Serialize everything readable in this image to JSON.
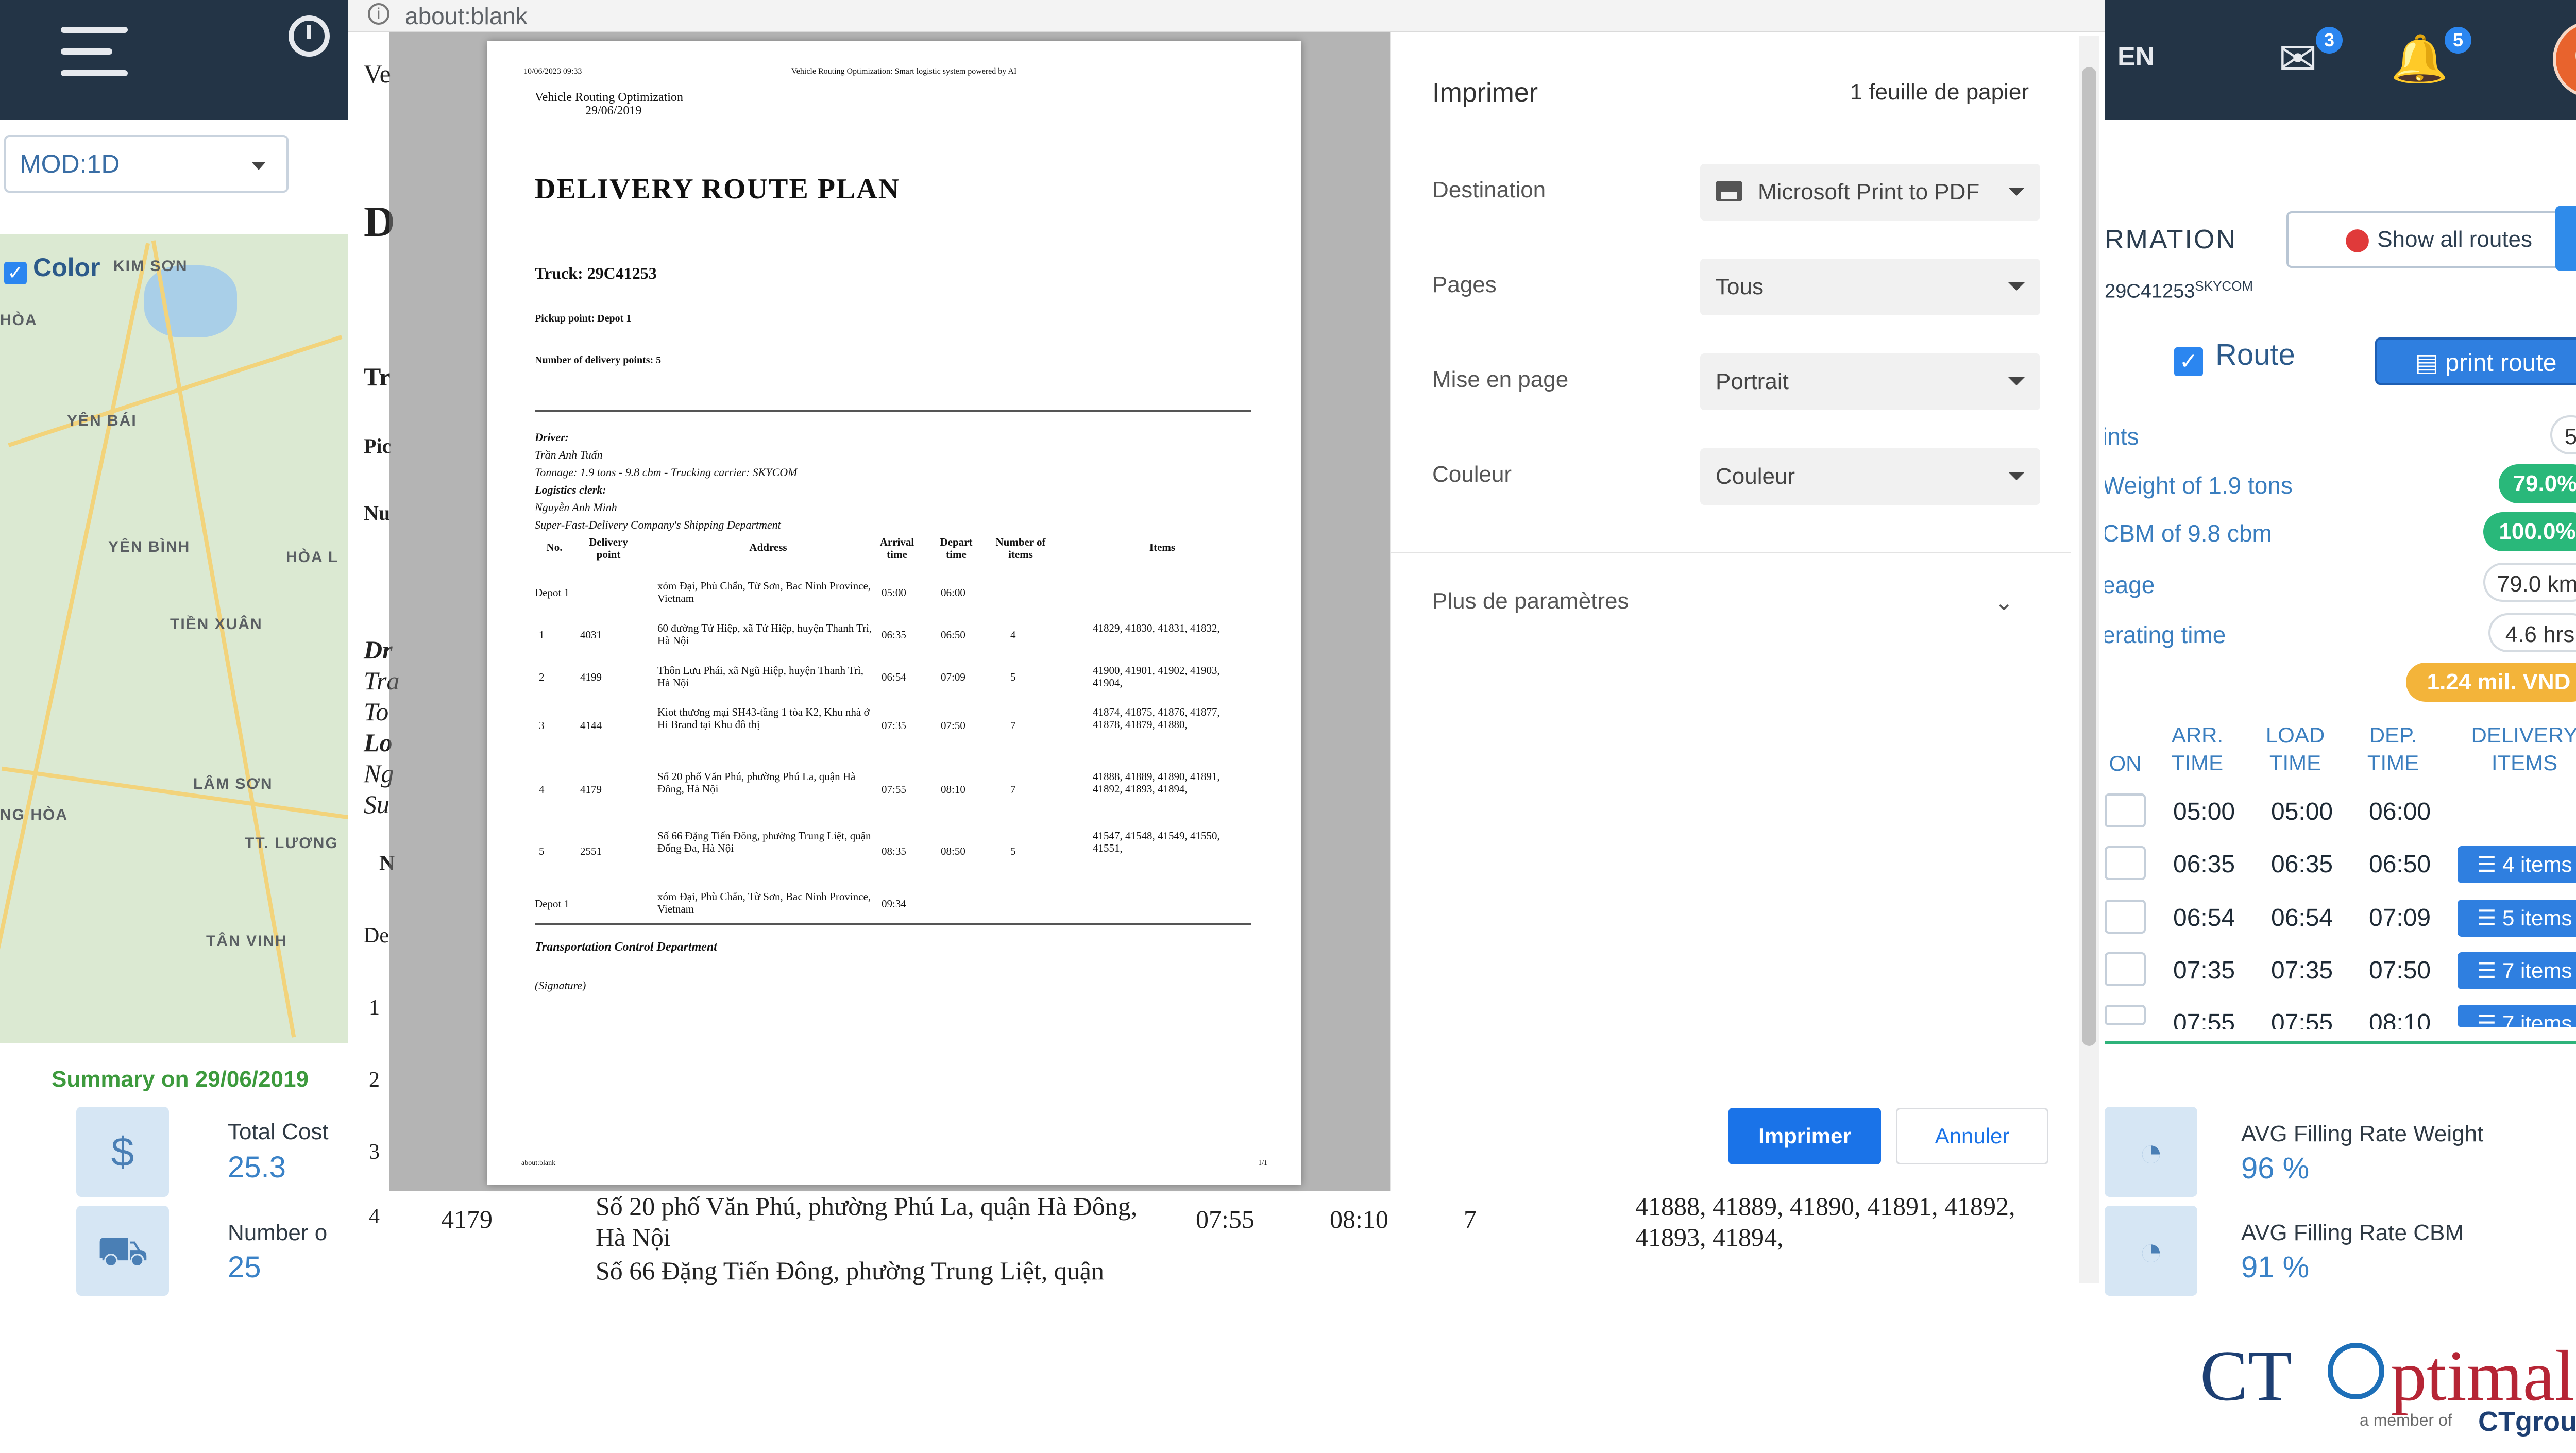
{
  "app": {
    "lang": "EN",
    "mail_badge": "3",
    "bell_badge": "5",
    "mode_select": "MOD:1D",
    "color_label": "Color",
    "map_places": [
      "KIM SƠN",
      "HÒA",
      "YÊN BÁI",
      "YÊN BÌNH",
      "HÒA L",
      "TIỀN XUÂN",
      "LÂM SƠN",
      "NG HÒA",
      "TT. LƯƠNG",
      "TÂN VINH"
    ],
    "summary_title": "Summary on 29/06/2019",
    "total_cost_label": "Total Cost",
    "total_cost_value": "25.3",
    "number_label": "Number o",
    "number_value": "25",
    "left_letters": [
      "Ve",
      "D",
      "Tr",
      "Pic",
      "Nu",
      "Dr",
      "Tra",
      "To",
      "Lo",
      "Ng",
      "Su",
      "N",
      "De",
      "1",
      "2",
      "3",
      "4"
    ],
    "bg_row4": {
      "no": "4",
      "point": "4179",
      "address_1": "Số 20 phố Văn Phú, phường Phú La, quận Hà Đông,",
      "address_2": "Hà Nội",
      "arrive": "07:55",
      "depart": "08:10",
      "num": "7",
      "items_1": "41888, 41889, 41890, 41891, 41892,",
      "items_2": "41893, 41894,"
    },
    "bg_row5_address": "Số 66 Đặng Tiến Đông, phường Trung Liệt, quận"
  },
  "right_panel": {
    "title": "RMATION",
    "show_all_routes": "Show all routes",
    "truck_code": "29C41253",
    "truck_tag": "SKYCOM",
    "route_label": "Route",
    "print_route": "print route",
    "rows": [
      {
        "label": "ints",
        "value": "5",
        "style": "grey"
      },
      {
        "label": "Weight of 1.9 tons",
        "value": "79.0%",
        "style": "green"
      },
      {
        "label": "CBM of 9.8 cbm",
        "value": "100.0%",
        "style": "green"
      },
      {
        "label": "eage",
        "value": "79.0 km",
        "style": "grey"
      },
      {
        "label": "erating time",
        "value": "4.6 hrs",
        "style": "grey"
      },
      {
        "label": "",
        "value": "1.24 mil. VND",
        "style": "orange"
      }
    ],
    "table_headers": [
      "ON",
      "ARR.\nTIME",
      "LOAD\nTIME",
      "DEP.\nTIME",
      "DELIVERY\nITEMS"
    ],
    "table_rows": [
      {
        "arr": "05:00",
        "load": "05:00",
        "dep": "06:00",
        "items": ""
      },
      {
        "arr": "06:35",
        "load": "06:35",
        "dep": "06:50",
        "items": "4 items"
      },
      {
        "arr": "06:54",
        "load": "06:54",
        "dep": "07:09",
        "items": "5 items"
      },
      {
        "arr": "07:35",
        "load": "07:35",
        "dep": "07:50",
        "items": "7 items"
      },
      {
        "arr": "07:55",
        "load": "07:55",
        "dep": "08:10",
        "items": "7 items"
      }
    ],
    "avg_weight_label": "AVG Filling Rate Weight",
    "avg_weight_value": "96 %",
    "avg_cbm_label": "AVG Filling Rate CBM",
    "avg_cbm_value": "91 %"
  },
  "browser": {
    "url": "about:blank"
  },
  "sheet": {
    "header_left": "10/06/2023 09:33",
    "header_center": "Vehicle Routing Optimization: Smart logistic system powered by AI",
    "vro": "Vehicle Routing Optimization",
    "vro_date": "29/06/2019",
    "title": "DELIVERY ROUTE PLAN",
    "truck": "Truck: 29C41253",
    "pickup": "Pickup point: Depot 1",
    "num_points": "Number of delivery points: 5",
    "driver_lines": [
      {
        "text": "Driver:",
        "bold": true
      },
      {
        "text": "Trần Anh Tuấn",
        "bold": false
      },
      {
        "text": "Tonnage: 1.9 tons - 9.8 cbm - Trucking carrier: SKYCOM",
        "bold": false
      },
      {
        "text": "Logistics clerk:",
        "bold": true
      },
      {
        "text": "Nguyễn Anh Minh",
        "bold": false
      },
      {
        "text": "Super-Fast-Delivery Company's Shipping Department",
        "bold": false
      }
    ],
    "table_headers": [
      "No.",
      "Delivery point",
      "Address",
      "Arrival time",
      "Depart time",
      "Number of items",
      "Items"
    ],
    "table_rows": [
      {
        "no": "Depot 1",
        "point": "",
        "address": "xóm Đại, Phù Chẩn, Từ Sơn, Bac Ninh Province, Vietnam",
        "arr": "05:00",
        "dep": "06:00",
        "num": "",
        "items": ""
      },
      {
        "no": "1",
        "point": "4031",
        "address": "60 đường Tứ Hiệp, xã Tứ Hiệp, huyện Thanh Trì, Hà Nội",
        "arr": "06:35",
        "dep": "06:50",
        "num": "4",
        "items": "41829, 41830, 41831, 41832,"
      },
      {
        "no": "2",
        "point": "4199",
        "address": "Thôn Lưu Phái, xã Ngũ Hiệp, huyện Thanh Trì, Hà Nội",
        "arr": "06:54",
        "dep": "07:09",
        "num": "5",
        "items": "41900, 41901, 41902, 41903, 41904,"
      },
      {
        "no": "3",
        "point": "4144",
        "address": "Kiot thương mại SH43-tầng 1 tòa K2, Khu nhà ở Hi Brand tại Khu đô thị",
        "arr": "07:35",
        "dep": "07:50",
        "num": "7",
        "items": "41874, 41875, 41876, 41877, 41878, 41879, 41880,"
      },
      {
        "no": "4",
        "point": "4179",
        "address": "Số 20 phố Văn Phú, phường Phú La, quận Hà Đông, Hà Nội",
        "arr": "07:55",
        "dep": "08:10",
        "num": "7",
        "items": "41888, 41889, 41890, 41891, 41892, 41893, 41894,"
      },
      {
        "no": "5",
        "point": "2551",
        "address": "Số 66 Đặng Tiến Đông, phường Trung Liệt, quận Đống Đa, Hà Nội",
        "arr": "08:35",
        "dep": "08:50",
        "num": "5",
        "items": "41547, 41548, 41549, 41550, 41551,"
      },
      {
        "no": "Depot 1",
        "point": "",
        "address": "xóm Đại, Phù Chẩn, Từ Sơn, Bac Ninh Province, Vietnam",
        "arr": "09:34",
        "dep": "",
        "num": "",
        "items": ""
      }
    ],
    "footer_dept": "Transportation Control Department",
    "footer_sig": "(Signature)",
    "page_left": "about:blank",
    "page_right": "1/1"
  },
  "print_dialog": {
    "title": "Imprimer",
    "sheets": "1 feuille de papier",
    "destination_label": "Destination",
    "destination_value": "Microsoft Print to PDF",
    "pages_label": "Pages",
    "pages_value": "Tous",
    "layout_label": "Mise en page",
    "layout_value": "Portrait",
    "color_label": "Couleur",
    "color_value": "Couleur",
    "more_settings": "Plus de paramètres",
    "print_button": "Imprimer",
    "cancel_button": "Annuler"
  },
  "logo": {
    "ct": "CT",
    "rest": "ptimal",
    "member": "a member of",
    "group": "CTgroup"
  },
  "colors": {
    "topbar": "#233446",
    "accent": "#2f7fe0",
    "green_pill": "#29b87a",
    "orange_pill": "#f3b43a",
    "print_blue": "#1a73e8",
    "logo_red": "#b62535",
    "logo_navy": "#1d3f73"
  },
  "icons": [
    "menu-icon",
    "clock-icon",
    "mail-icon",
    "bell-icon",
    "avatar",
    "map-pin-icon",
    "list-icon",
    "printer-icon",
    "chevron-down-icon",
    "info-icon",
    "coins-icon",
    "truck-icon",
    "pie-chart-icon"
  ]
}
